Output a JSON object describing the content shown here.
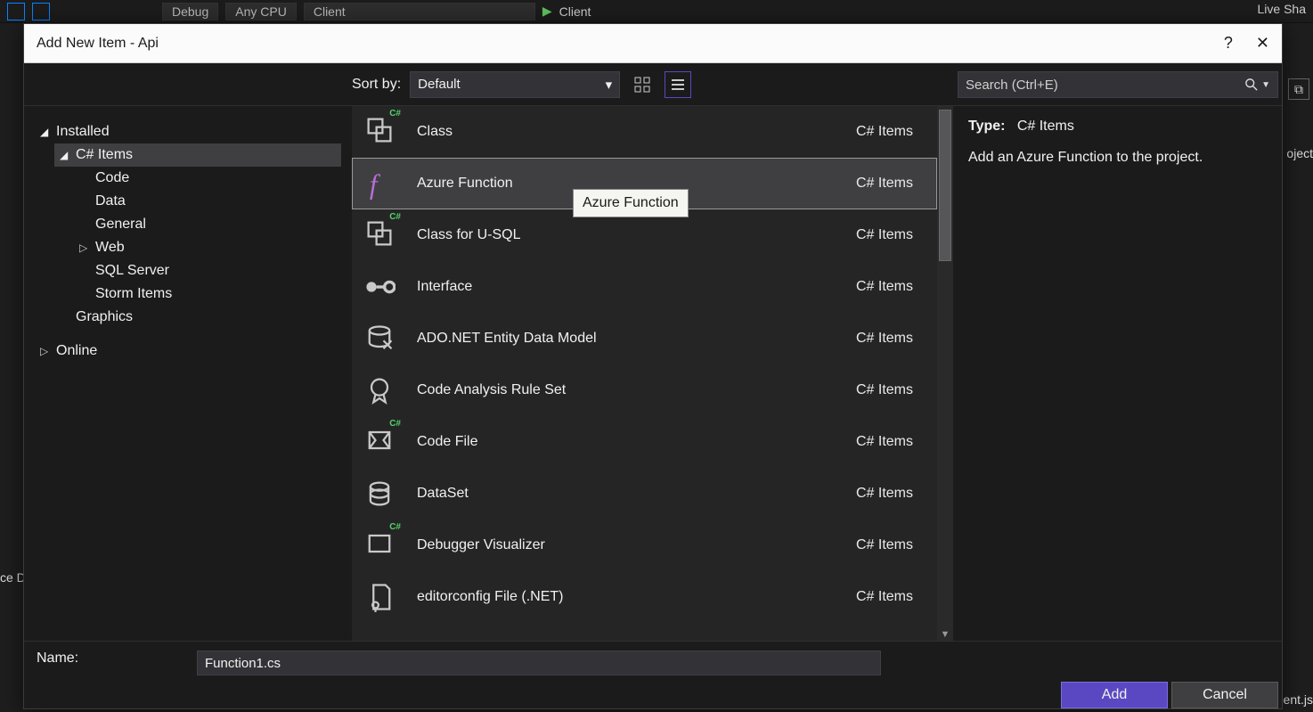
{
  "backgroundToolbar": {
    "buildConfig": "Debug",
    "platform": "Any CPU",
    "startupProject": "Client",
    "runLabel": "Client",
    "liveShare": "Live Sha"
  },
  "backgroundSide": {
    "rightText1": "oject",
    "rightText2": "ent.js",
    "leftText": "ce D"
  },
  "dialog": {
    "title": "Add New Item - Api",
    "helpGlyph": "?",
    "closeGlyph": "✕"
  },
  "tree": {
    "installed": "Installed",
    "csharp": "C# Items",
    "children": [
      "Code",
      "Data",
      "General",
      "Web",
      "SQL Server",
      "Storm Items"
    ],
    "graphics": "Graphics",
    "online": "Online"
  },
  "sortBy": {
    "label": "Sort by:",
    "value": "Default"
  },
  "search": {
    "placeholder": "Search (Ctrl+E)"
  },
  "templates": [
    {
      "name": "Class",
      "category": "C# Items",
      "icon": "class"
    },
    {
      "name": "Azure Function",
      "category": "C# Items",
      "icon": "azure-fn",
      "selected": true
    },
    {
      "name": "Class for U-SQL",
      "category": "C# Items",
      "icon": "class"
    },
    {
      "name": "Interface",
      "category": "C# Items",
      "icon": "interface"
    },
    {
      "name": "ADO.NET Entity Data Model",
      "category": "C# Items",
      "icon": "ado"
    },
    {
      "name": "Code Analysis Rule Set",
      "category": "C# Items",
      "icon": "ruleset"
    },
    {
      "name": "Code File",
      "category": "C# Items",
      "icon": "codefile"
    },
    {
      "name": "DataSet",
      "category": "C# Items",
      "icon": "dataset"
    },
    {
      "name": "Debugger Visualizer",
      "category": "C# Items",
      "icon": "debugvis"
    },
    {
      "name": "editorconfig File (.NET)",
      "category": "C# Items",
      "icon": "editorconfig"
    }
  ],
  "tooltip": "Azure Function",
  "preview": {
    "typeLabel": "Type:",
    "typeValue": "C# Items",
    "description": "Add an Azure Function to the project."
  },
  "name": {
    "label": "Name:",
    "value": "Function1.cs"
  },
  "buttons": {
    "add": "Add",
    "cancel": "Cancel"
  }
}
